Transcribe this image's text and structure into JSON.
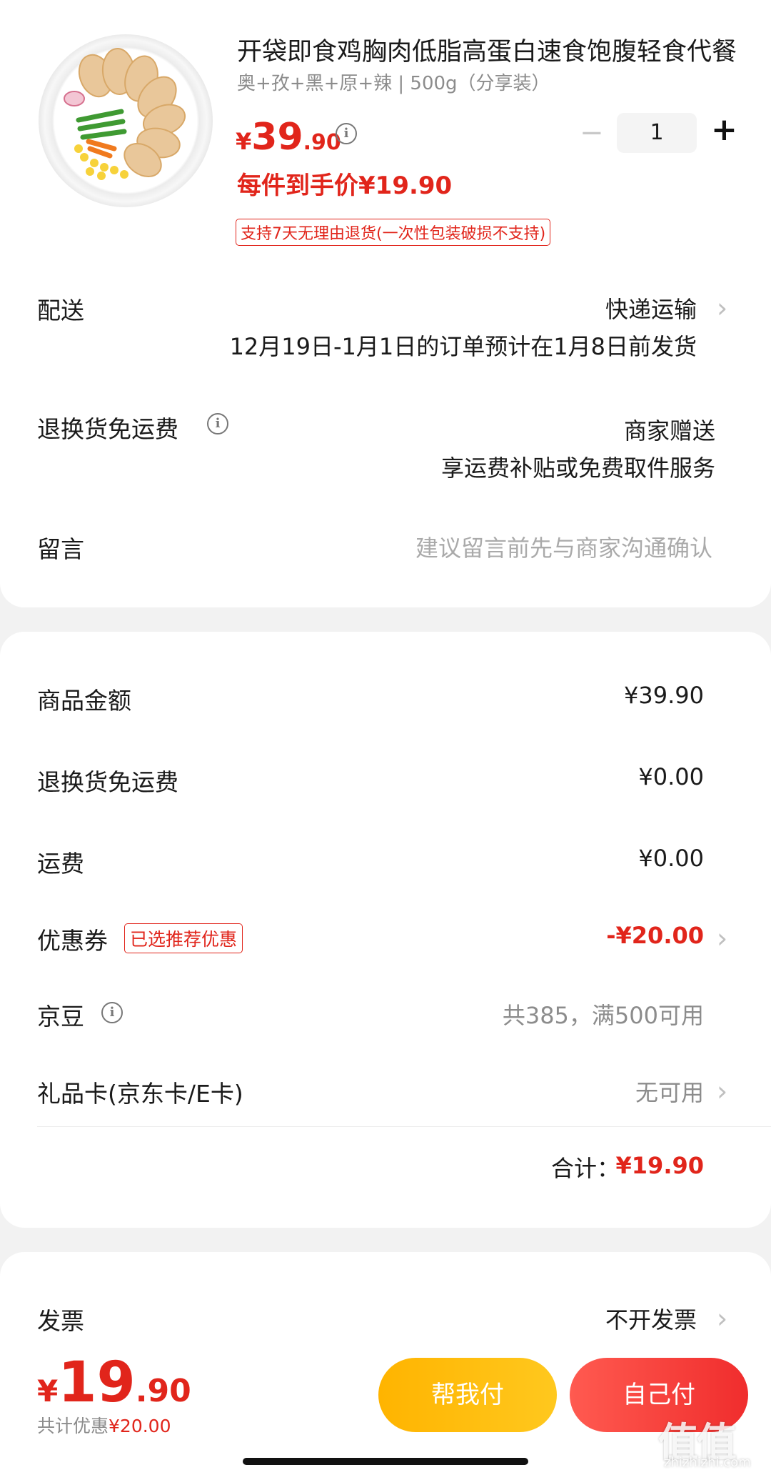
{
  "product": {
    "title": "开袋即食鸡胸肉低脂高蛋白速食饱腹轻食代餐",
    "spec": "奥+孜+黑+原+辣 | 500g（分享装）",
    "price_currency": "¥",
    "price_int": "39",
    "price_dec": ".90",
    "info_glyph": "i",
    "quantity": "1",
    "minus_glyph": "−",
    "plus_glyph": "+",
    "unit_price": "每件到手价¥19.90",
    "return_policy": "支持7天无理由退货(一次性包装破损不支持)"
  },
  "delivery": {
    "label": "配送",
    "method": "快递运输",
    "note": "12月19日-1月1日的订单预计在1月8日前发货"
  },
  "return_shipping": {
    "label": "退换货免运费",
    "value": "商家赠送",
    "note": "享运费补贴或免费取件服务"
  },
  "message": {
    "label": "留言",
    "placeholder": "建议留言前先与商家沟通确认"
  },
  "summary": {
    "goods_label": "商品金额",
    "goods_value": "¥39.90",
    "return_label": "退换货免运费",
    "return_value": "¥0.00",
    "freight_label": "运费",
    "freight_value": "¥0.00",
    "coupon_label": "优惠券",
    "coupon_tag": "已选推荐优惠",
    "coupon_value": "-¥20.00",
    "beans_label": "京豆",
    "beans_value": "共385，满500可用",
    "giftcard_label": "礼品卡(京东卡/E卡)",
    "giftcard_value": "无可用",
    "total_label": "合计：",
    "total_value": "¥19.90"
  },
  "invoice": {
    "label": "发票",
    "value": "不开发票"
  },
  "bottom": {
    "currency": "¥",
    "total_int": "19",
    "total_dec": ".90",
    "saving_label": "共计优惠",
    "saving_value": "¥20.00",
    "friend_pay": "帮我付",
    "self_pay": "自己付"
  },
  "watermark": {
    "text": "值值值",
    "url": "zhizhizhi.com"
  },
  "icons": {
    "chevron": "›"
  },
  "colors": {
    "accent_red": "#e1251b",
    "friend_pay_yellow": "#ffb400",
    "self_pay_red": "#f02d2d"
  }
}
